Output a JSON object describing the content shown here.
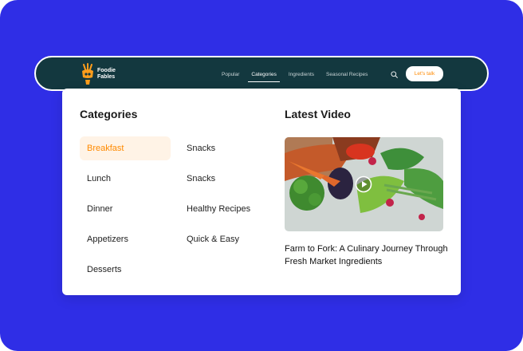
{
  "brand": {
    "name_line1": "Foodie",
    "name_line2": "Fables"
  },
  "nav": {
    "links": [
      "Popular",
      "Categories",
      "Ingredients",
      "Seasonal Recipes"
    ],
    "active_index": 1,
    "search_icon": "search-icon",
    "cta_label": "Let's talk"
  },
  "categories": {
    "title": "Categories",
    "column1": [
      "Breakfast",
      "Lunch",
      "Dinner",
      "Appetizers",
      "Desserts"
    ],
    "column2": [
      "Snacks",
      "Snacks",
      "Healthy Recipes",
      "Quick & Easy"
    ],
    "active_item": "Breakfast"
  },
  "latest_video": {
    "title": "Latest Video",
    "caption": "Farm to Fork: A Culinary Journey Through Fresh Market Ingredients",
    "play_icon": "play-icon"
  },
  "colors": {
    "background": "#2f2ee6",
    "navbar": "#13383f",
    "accent": "#ff8a00",
    "active_item_bg": "#fff3e6"
  }
}
